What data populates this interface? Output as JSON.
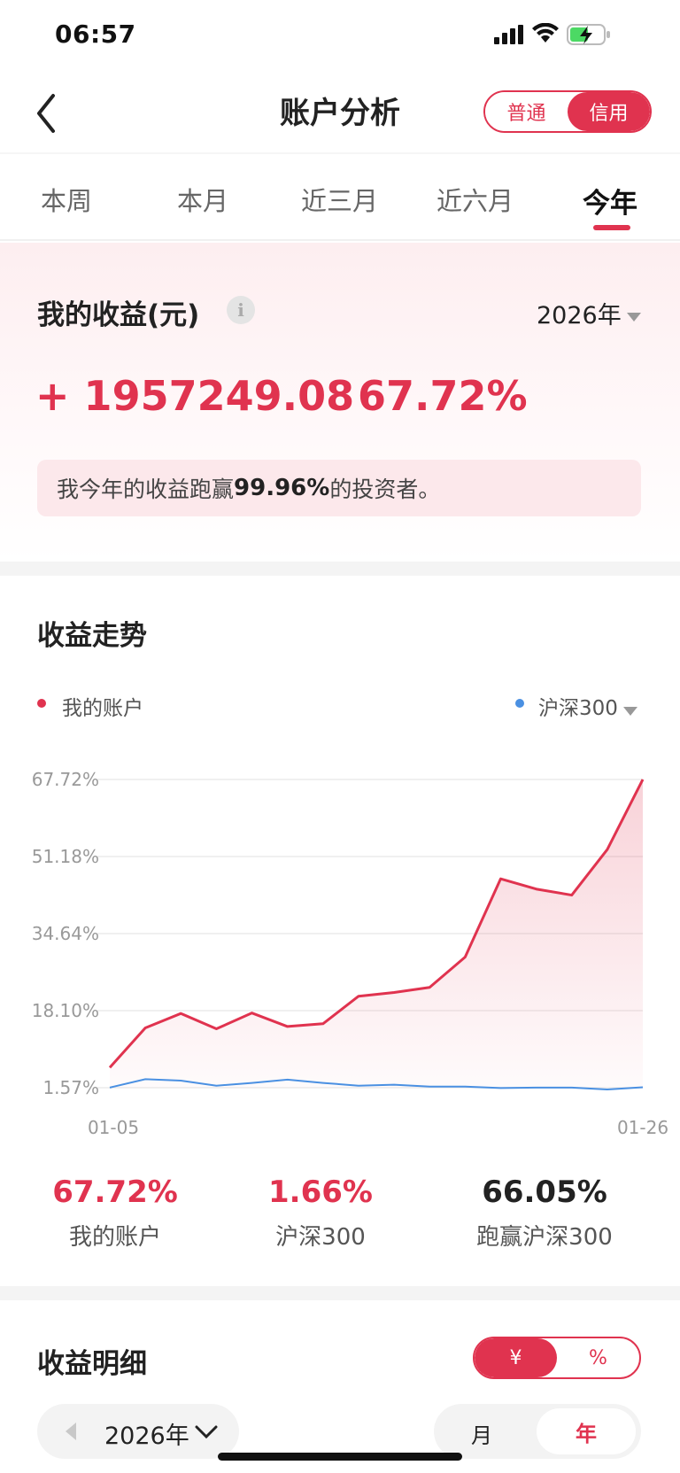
{
  "status_bar": {
    "time": "06:57"
  },
  "header": {
    "title": "账户分析",
    "account_types": [
      "普通",
      "信用"
    ],
    "active_account_type": "信用"
  },
  "period_tabs": {
    "items": [
      "本周",
      "本月",
      "近三月",
      "近六月",
      "今年"
    ],
    "active": "今年"
  },
  "income": {
    "title": "我的收益(元)",
    "info_icon": "i",
    "year": "2026年",
    "amount": "+ 1957249.08",
    "rate": "67.72%",
    "beat_prefix": "我今年的收益跑赢",
    "beat_value": "99.96%",
    "beat_suffix": "的投资者。"
  },
  "trend": {
    "title": "收益走势",
    "legend_mine": "我的账户",
    "legend_index": "沪深300",
    "colors": {
      "mine": "#e0334f",
      "index": "#4a90e2"
    }
  },
  "chart_data": {
    "type": "line",
    "y_ticks": [
      "67.72%",
      "51.18%",
      "34.64%",
      "18.10%",
      "1.57%"
    ],
    "ylim": [
      1.57,
      67.72
    ],
    "x_start_label": "01-05",
    "x_end_label": "01-26",
    "series": [
      {
        "name": "我的账户",
        "values": [
          5.9,
          14.4,
          17.5,
          14.2,
          17.6,
          14.7,
          15.3,
          21.2,
          22.0,
          23.1,
          29.6,
          46.4,
          44.2,
          42.9,
          52.7,
          67.72
        ]
      },
      {
        "name": "沪深300",
        "values": [
          1.6,
          3.4,
          3.1,
          2.0,
          2.6,
          3.3,
          2.6,
          2.0,
          2.2,
          1.8,
          1.8,
          1.5,
          1.6,
          1.6,
          1.2,
          1.66
        ]
      }
    ]
  },
  "stats": [
    {
      "value": "67.72%",
      "label": "我的账户",
      "color": "#e0334f"
    },
    {
      "value": "1.66%",
      "label": "沪深300",
      "color": "#e0334f"
    },
    {
      "value": "66.05%",
      "label": "跑赢沪深300",
      "color": "#222222"
    }
  ],
  "detail": {
    "title": "收益明细",
    "unit_options": [
      "¥",
      "%"
    ],
    "active_unit": "¥",
    "year": "2026年",
    "period_options": [
      "月",
      "年"
    ],
    "active_period": "年"
  }
}
